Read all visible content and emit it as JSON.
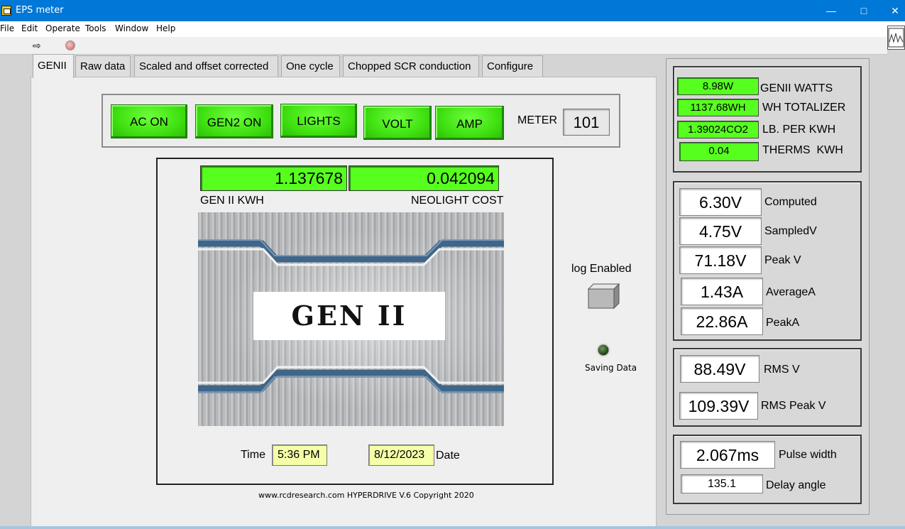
{
  "window": {
    "title": "EPS meter"
  },
  "menu": [
    "File",
    "Edit",
    "Operate",
    "Tools",
    "Window",
    "Help"
  ],
  "tabs": [
    "GENII",
    "Raw data",
    "Scaled and offset corrected",
    "One cycle",
    "Chopped SCR conduction",
    "Configure"
  ],
  "buttons": {
    "ac_on": "AC ON",
    "gen2_on": "GEN2 ON",
    "lights": "LIGHTS",
    "volt": "VOLT",
    "amp": "AMP"
  },
  "meter": {
    "label": "METER",
    "value": "101"
  },
  "readouts": {
    "gen2_kwh": {
      "value": "1.137678",
      "label": "GEN II KWH"
    },
    "neolight_cost": {
      "value": "0.042094",
      "label": "NEOLIGHT COST"
    }
  },
  "logo": {
    "text": "GEN II"
  },
  "time": {
    "label": "Time",
    "value": "5:36 PM"
  },
  "date": {
    "label": "Date",
    "value": "8/12/2023"
  },
  "copyright": "www.rcdresearch.com HYPERDRIVE V.6 Copyright 2020",
  "log": {
    "label": "log Enabled"
  },
  "saving": {
    "label": "Saving Data"
  },
  "power_group": [
    {
      "value": "8.98W",
      "label": "GENII WATTS"
    },
    {
      "value": "1137.68WH",
      "label": "WH TOTALIZER"
    },
    {
      "value": "1.39024CO2",
      "label": "LB. PER KWH"
    },
    {
      "value": "0.04",
      "label": "THERMS  KWH"
    }
  ],
  "measure_group": [
    {
      "value": "6.30V",
      "label": "Computed"
    },
    {
      "value": "4.75V",
      "label": "SampledV"
    },
    {
      "value": "71.18V",
      "label": "Peak V"
    },
    {
      "value": "1.43A",
      "label": "AverageA"
    },
    {
      "value": "22.86A",
      "label": "PeakA"
    }
  ],
  "rms_group": [
    {
      "value": "88.49V",
      "label": "RMS V"
    },
    {
      "value": "109.39V",
      "label": "RMS Peak V"
    }
  ],
  "pulse_group": [
    {
      "value": "2.067ms",
      "label": "Pulse width"
    },
    {
      "value": "135.1",
      "label": "Delay angle"
    }
  ],
  "colors": {
    "titlebar": "#0078d7",
    "indicator_green": "#57ff1f",
    "button_green": "#3fe010",
    "date_yellow": "#f6ffa8"
  }
}
